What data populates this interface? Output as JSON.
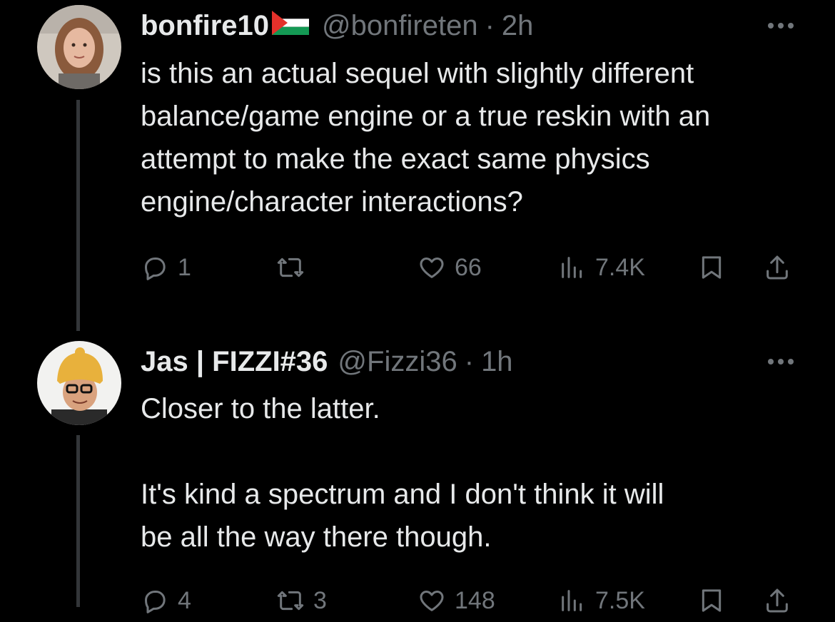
{
  "tweets": [
    {
      "display_name": "bonfire10",
      "flag_icon": "palestine-flag-icon",
      "handle": "@bonfireten",
      "separator": "·",
      "time": "2h",
      "text_lines": [
        "is this an actual sequel with slightly different",
        "balance/game engine or a true reskin with an",
        "attempt to make the exact same physics",
        "engine/character interactions?"
      ],
      "replies": "1",
      "retweets": "",
      "likes": "66",
      "views": "7.4K"
    },
    {
      "display_name": "Jas | FIZZI#36",
      "handle": "@Fizzi36",
      "separator": "·",
      "time": "1h",
      "text_lines": [
        "Closer to the latter.",
        "",
        "It's kind a spectrum and I don't think it will",
        "be all the way there though."
      ],
      "replies": "4",
      "retweets": "3",
      "likes": "148",
      "views": "7.5K"
    }
  ],
  "colors": {
    "background": "#000000",
    "text": "#e7e9ea",
    "muted": "#71767b",
    "thread_line": "#333639"
  }
}
